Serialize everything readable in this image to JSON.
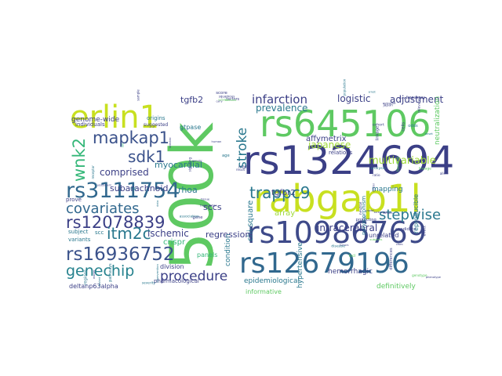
{
  "words": [
    {
      "text": "500k",
      "color": "#5ec962"
    },
    {
      "text": "rs1324694",
      "color": "#3b3f86"
    },
    {
      "text": "rabgap1l",
      "color": "#c8e020"
    },
    {
      "text": "rs645106",
      "color": "#5ec962"
    },
    {
      "text": "rs10986769",
      "color": "#3e4a89"
    },
    {
      "text": "rs12679196",
      "color": "#31688e"
    },
    {
      "text": "erlin1",
      "color": "#c8e020"
    },
    {
      "text": "rs3111754",
      "color": "#31688e"
    },
    {
      "text": "rs12078839",
      "color": "#3b3f86"
    },
    {
      "text": "rs16936752",
      "color": "#3b528b"
    },
    {
      "text": "genechip",
      "color": "#26828e"
    },
    {
      "text": "mapkap1",
      "color": "#3b528b"
    },
    {
      "text": "covariates",
      "color": "#31688e"
    },
    {
      "text": "itm2c",
      "color": "#2a788e"
    },
    {
      "text": "trappc9",
      "color": "#2a788e"
    },
    {
      "text": "stepwise",
      "color": "#2a788e"
    },
    {
      "text": "procedure",
      "color": "#3b3f86"
    },
    {
      "text": "sdk1",
      "color": "#3b528b"
    },
    {
      "text": "wnk2",
      "color": "#35b779"
    },
    {
      "text": "stroke",
      "color": "#2a788e"
    },
    {
      "text": "infarction",
      "color": "#3b3f86"
    },
    {
      "text": "multivariable",
      "color": "#a0da39"
    },
    {
      "text": "japanese",
      "color": "#a0da39"
    },
    {
      "text": "comprised",
      "color": "#3b3f86"
    },
    {
      "text": "subarachnoid",
      "color": "#3b3f86"
    },
    {
      "text": "myocardial",
      "color": "#2a788e"
    },
    {
      "text": "ischemic",
      "color": "#3b3f86"
    },
    {
      "text": "logistic",
      "color": "#3b3f86"
    },
    {
      "text": "adjustment",
      "color": "#3b3f86"
    },
    {
      "text": "prevalence",
      "color": "#2a788e"
    },
    {
      "text": "intracerebral",
      "color": "#3b3f86"
    },
    {
      "text": "chi-square",
      "color": "#2a788e"
    },
    {
      "text": "regression",
      "color": "#3b3f86"
    },
    {
      "text": "tgfb2",
      "color": "#3b3f86"
    },
    {
      "text": "tgfbr2",
      "color": "#3b3f86"
    },
    {
      "text": "genome-wide",
      "color": "#3b3f86"
    },
    {
      "text": "affymetrix",
      "color": "#3b3f86"
    },
    {
      "text": "rhoa",
      "color": "#2a788e"
    },
    {
      "text": "sccs",
      "color": "#3b3f86"
    },
    {
      "text": "crispr",
      "color": "#35b779"
    },
    {
      "text": "array",
      "color": "#a0da39"
    },
    {
      "text": "hemorrhagic",
      "color": "#3b3f86"
    },
    {
      "text": "hypertensive",
      "color": "#2a788e"
    },
    {
      "text": "epidemiological",
      "color": "#2a788e"
    },
    {
      "text": "informative",
      "color": "#5ec962"
    },
    {
      "text": "definitively",
      "color": "#5ec962"
    },
    {
      "text": "deltanp63alpha",
      "color": "#3b3f86"
    },
    {
      "text": "division",
      "color": "#3b3f86"
    },
    {
      "text": "gtpase",
      "color": "#2a788e"
    },
    {
      "text": "neutralization",
      "color": "#5ec962"
    },
    {
      "text": "individuals",
      "color": "#3b3f86"
    },
    {
      "text": "origins",
      "color": "#2a788e"
    },
    {
      "text": "subject",
      "color": "#2a788e"
    },
    {
      "text": "variants",
      "color": "#2a788e"
    },
    {
      "text": "condition",
      "color": "#2a788e"
    },
    {
      "text": "polymorphism",
      "color": "#2a788e"
    },
    {
      "text": "unrelated",
      "color": "#3b3f86"
    },
    {
      "text": "panels",
      "color": "#35b779"
    },
    {
      "text": "relations",
      "color": "#3b3f86"
    },
    {
      "text": "mapping",
      "color": "#2a788e"
    },
    {
      "text": "reproducible",
      "color": "#2a788e"
    },
    {
      "text": "suggested",
      "color": "#3b3f86"
    },
    {
      "text": "pharmacological",
      "color": "#3b3f86"
    },
    {
      "text": "scc",
      "color": "#2a788e"
    },
    {
      "text": "prove",
      "color": "#3b3f86"
    }
  ],
  "small_words": [
    {
      "text": "set",
      "color": "#35b779"
    },
    {
      "text": "carry",
      "color": "#3b3f86"
    },
    {
      "text": "survival",
      "color": "#3b3f86"
    },
    {
      "text": "relevance",
      "color": "#3b3f86"
    },
    {
      "text": "lineage",
      "color": "#5ec962"
    },
    {
      "text": "candidate",
      "color": "#3b3f86"
    },
    {
      "text": "regions",
      "color": "#2a788e"
    },
    {
      "text": "neutral",
      "color": "#3b3f86"
    },
    {
      "text": "signaling",
      "color": "#3b3f86"
    },
    {
      "text": "transcription",
      "color": "#3b3f86"
    },
    {
      "text": "tumors",
      "color": "#3b3f86"
    },
    {
      "text": "receptor",
      "color": "#2a788e"
    },
    {
      "text": "factors",
      "color": "#3b3f86"
    },
    {
      "text": "population",
      "color": "#2a788e"
    },
    {
      "text": "cohort",
      "color": "#3b3f86"
    },
    {
      "text": "allele",
      "color": "#3b3f86"
    },
    {
      "text": "genotype",
      "color": "#5ec962"
    },
    {
      "text": "pathways",
      "color": "#2a788e"
    },
    {
      "text": "protecting",
      "color": "#3b3f86"
    },
    {
      "text": "major",
      "color": "#3b3f86"
    },
    {
      "text": "tissue",
      "color": "#3b3f86"
    },
    {
      "text": "disease",
      "color": "#2a788e"
    },
    {
      "text": "assessment",
      "color": "#3b3f86"
    },
    {
      "text": "elevated",
      "color": "#5ec962"
    },
    {
      "text": "japan",
      "color": "#3b3f86"
    },
    {
      "text": "linkage",
      "color": "#3b3f86"
    },
    {
      "text": "analysis",
      "color": "#2a788e"
    },
    {
      "text": "phenotype",
      "color": "#3b3f86"
    },
    {
      "text": "marker",
      "color": "#3b3f86"
    },
    {
      "text": "risk",
      "color": "#2a788e"
    },
    {
      "text": "human",
      "color": "#3b3f86"
    },
    {
      "text": "data",
      "color": "#2a788e"
    },
    {
      "text": "trait",
      "color": "#3b3f86"
    },
    {
      "text": "sample",
      "color": "#3b3f86"
    },
    {
      "text": "variation",
      "color": "#5ec962"
    },
    {
      "text": "outcome",
      "color": "#3b3f86"
    },
    {
      "text": "onset",
      "color": "#2a788e"
    },
    {
      "text": "control",
      "color": "#3b3f86"
    },
    {
      "text": "cases",
      "color": "#3b3f86"
    },
    {
      "text": "severity",
      "color": "#2a788e"
    },
    {
      "text": "model",
      "color": "#3b3f86"
    },
    {
      "text": "age",
      "color": "#2a788e"
    },
    {
      "text": "gene",
      "color": "#3b3f86"
    },
    {
      "text": "loci",
      "color": "#5ec962"
    },
    {
      "text": "snp",
      "color": "#2a788e"
    },
    {
      "text": "score",
      "color": "#3b3f86"
    },
    {
      "text": "frequency",
      "color": "#3b3f86"
    },
    {
      "text": "odds",
      "color": "#2a788e"
    },
    {
      "text": "ratio",
      "color": "#3b3f86"
    },
    {
      "text": "effect",
      "color": "#3b3f86"
    },
    {
      "text": "tested",
      "color": "#2a788e"
    },
    {
      "text": "samples",
      "color": "#3b3f86"
    },
    {
      "text": "genetic",
      "color": "#3b3f86"
    },
    {
      "text": "association",
      "color": "#2a788e"
    },
    {
      "text": "subjects",
      "color": "#5ec962"
    },
    {
      "text": "selected",
      "color": "#3b3f86"
    },
    {
      "text": "squamous",
      "color": "#3b3f86"
    },
    {
      "text": "arrest",
      "color": "#2a788e"
    },
    {
      "text": "cells",
      "color": "#3b3f86"
    },
    {
      "text": "beneficial",
      "color": "#5ec962"
    },
    {
      "text": "differences",
      "color": "#3b3f86"
    },
    {
      "text": "intervention",
      "color": "#2a788e"
    },
    {
      "text": "screened",
      "color": "#3b3f86"
    },
    {
      "text": "result",
      "color": "#3b3f86"
    }
  ]
}
